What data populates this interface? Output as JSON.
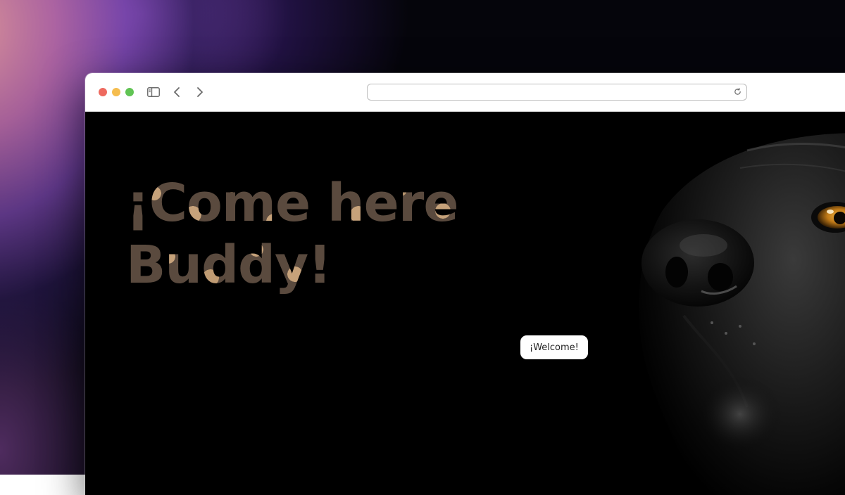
{
  "browser": {
    "address_text": "",
    "icons": {
      "close": "close-traffic-light",
      "minimize": "minimize-traffic-light",
      "maximize": "maximize-traffic-light",
      "sidebar": "sidebar-icon",
      "back": "chevron-left-icon",
      "forward": "chevron-right-icon",
      "reload": "reload-icon"
    }
  },
  "page": {
    "headline": "¡Come here\nBuddy!",
    "welcome_label": "¡Welcome!"
  },
  "colors": {
    "traffic_close": "#ee6a5f",
    "traffic_minimize": "#f5bd4f",
    "traffic_maximize": "#61c454",
    "headline_base": "#5a4a3e",
    "headline_spots": "#c6a27a",
    "page_background": "#000000",
    "dog_eye": "#d08a1e"
  }
}
